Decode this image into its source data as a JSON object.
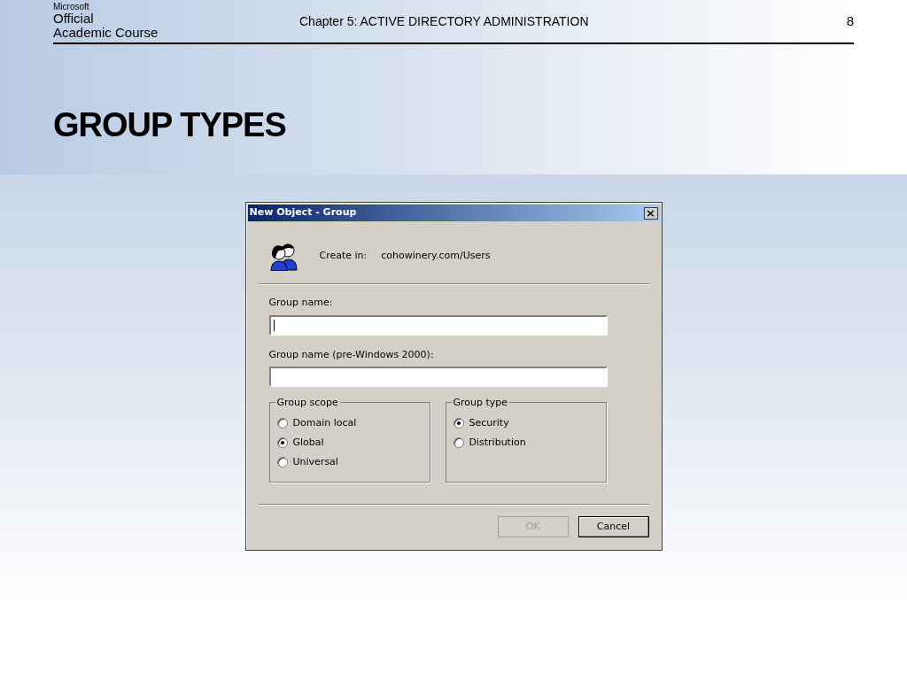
{
  "slide_header": {
    "logo": {
      "brand": "Microsoft",
      "line_1": "Official",
      "line_2": "Academic Course"
    },
    "chapter": "Chapter 5: ACTIVE DIRECTORY ADMINISTRATION",
    "page_number": "8"
  },
  "slide_title": "GROUP TYPES",
  "dialog": {
    "title": "New Object - Group",
    "close_glyph": "×",
    "create_in_label": "Create in:",
    "create_in_value": "cohowinery.com/Users",
    "fields": [
      {
        "label": "Group name:",
        "focused": true
      },
      {
        "label": "Group name (pre-Windows 2000):",
        "focused": false
      }
    ],
    "groups": [
      {
        "title": "Group scope",
        "options": [
          {
            "label": "Domain local",
            "selected": false
          },
          {
            "label": "Global",
            "selected": true
          },
          {
            "label": "Universal",
            "selected": false
          }
        ]
      },
      {
        "title": "Group type",
        "options": [
          {
            "label": "Security",
            "selected": true
          },
          {
            "label": "Distribution",
            "selected": false
          }
        ]
      }
    ],
    "buttons": [
      {
        "label": "OK",
        "disabled": true
      },
      {
        "label": "Cancel",
        "disabled": false
      }
    ]
  }
}
